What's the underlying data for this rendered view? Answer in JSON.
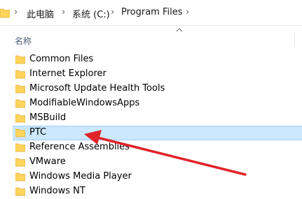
{
  "breadcrumb": {
    "items": [
      "此电脑",
      "系统 (C:)",
      "Program Files"
    ],
    "separator": "›"
  },
  "list": {
    "column_header": "名称",
    "sort": "ascending",
    "selected": "PTC",
    "items": [
      {
        "name": "Common Files"
      },
      {
        "name": "Internet Explorer"
      },
      {
        "name": "Microsoft Update Health Tools"
      },
      {
        "name": "ModifiableWindowsApps"
      },
      {
        "name": "MSBuild"
      },
      {
        "name": "PTC"
      },
      {
        "name": "Reference Assemblies"
      },
      {
        "name": "VMware"
      },
      {
        "name": "Windows Media Player"
      },
      {
        "name": "Windows NT"
      }
    ]
  },
  "colors": {
    "selection_bg": "#cce8ff",
    "selection_border": "#99d1ff",
    "folder": "#ffd45c",
    "arrow": "#e0242a"
  },
  "icons": {
    "folder": "folder-icon",
    "sort": "sort-ascending-icon",
    "annotation": "red-arrow"
  }
}
